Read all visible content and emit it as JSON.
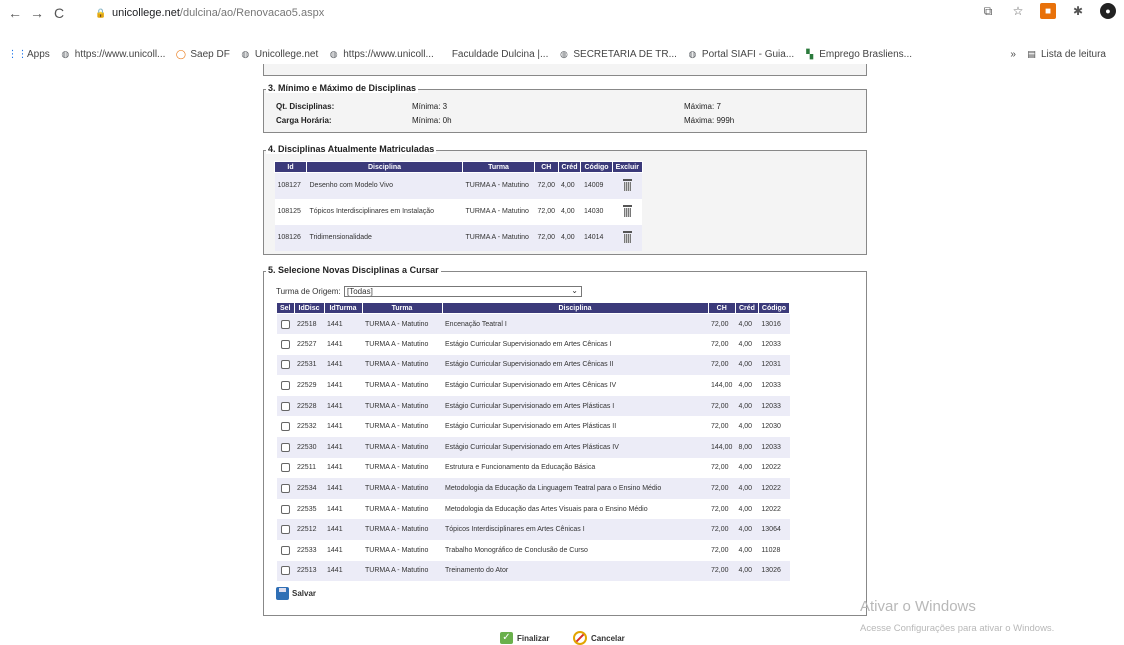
{
  "browser": {
    "url_host": "unicollege.net",
    "url_path": "/dulcina/ao/Renovacao5.aspx",
    "bookmarks": [
      {
        "label": "Apps",
        "icon": "apps-grid-icon"
      },
      {
        "label": "https://www.unicoll...",
        "icon": "globe-icon"
      },
      {
        "label": "Saep DF",
        "icon": "saep-icon"
      },
      {
        "label": "Unicollege.net",
        "icon": "globe-icon"
      },
      {
        "label": "https://www.unicoll...",
        "icon": "globe-icon"
      },
      {
        "label": "Faculdade Dulcina |...",
        "icon": "blank-icon"
      },
      {
        "label": "SECRETARIA DE TR...",
        "icon": "globe-icon"
      },
      {
        "label": "Portal SIAFI - Guia...",
        "icon": "globe-icon"
      },
      {
        "label": "Emprego Brasliens...",
        "icon": "emprego-icon"
      }
    ],
    "more_glyph": "»",
    "reading_list": "Lista de leitura"
  },
  "section3": {
    "legend": "3. Mínimo e Máximo de Disciplinas",
    "rows": [
      {
        "label": "Qt. Disciplinas:",
        "min": "Mínima: 3",
        "max": "Máxima: 7"
      },
      {
        "label": "Carga Horária:",
        "min": "Mínima: 0h",
        "max": "Máxima: 999h"
      }
    ]
  },
  "section4": {
    "legend": "4. Disciplinas Atualmente Matriculadas",
    "headers": [
      "Id",
      "Disciplina",
      "Turma",
      "CH",
      "Créd",
      "Código",
      "Excluir"
    ],
    "rows": [
      {
        "id": "108127",
        "disciplina": "Desenho com Modelo Vivo",
        "turma": "TURMA A - Matutino",
        "ch": "72,00",
        "cred": "4,00",
        "codigo": "14009"
      },
      {
        "id": "108125",
        "disciplina": "Tópicos Interdisciplinares em Instalação",
        "turma": "TURMA A - Matutino",
        "ch": "72,00",
        "cred": "4,00",
        "codigo": "14030"
      },
      {
        "id": "108126",
        "disciplina": "Tridimensionalidade",
        "turma": "TURMA A - Matutino",
        "ch": "72,00",
        "cred": "4,00",
        "codigo": "14014"
      }
    ]
  },
  "section5": {
    "legend": "5. Selecione Novas Disciplinas a Cursar",
    "origin_label": "Turma de Origem:",
    "origin_value": "[Todas]",
    "headers": [
      "Sel",
      "IdDisc",
      "IdTurma",
      "Turma",
      "Disciplina",
      "CH",
      "Créd",
      "Código"
    ],
    "rows": [
      {
        "iddisc": "22518",
        "idturma": "1441",
        "turma": "TURMA A - Matutino",
        "disciplina": "Encenação Teatral I",
        "ch": "72,00",
        "cred": "4,00",
        "codigo": "13016"
      },
      {
        "iddisc": "22527",
        "idturma": "1441",
        "turma": "TURMA A - Matutino",
        "disciplina": "Estágio Curricular Supervisionado em Artes Cênicas I",
        "ch": "72,00",
        "cred": "4,00",
        "codigo": "12033"
      },
      {
        "iddisc": "22531",
        "idturma": "1441",
        "turma": "TURMA A - Matutino",
        "disciplina": "Estágio Curricular Supervisionado em Artes Cênicas II",
        "ch": "72,00",
        "cred": "4,00",
        "codigo": "12031"
      },
      {
        "iddisc": "22529",
        "idturma": "1441",
        "turma": "TURMA A - Matutino",
        "disciplina": "Estágio Curricular Supervisionado em Artes Cênicas IV",
        "ch": "144,00",
        "cred": "4,00",
        "codigo": "12033"
      },
      {
        "iddisc": "22528",
        "idturma": "1441",
        "turma": "TURMA A - Matutino",
        "disciplina": "Estágio Curricular Supervisionado em Artes Plásticas I",
        "ch": "72,00",
        "cred": "4,00",
        "codigo": "12033"
      },
      {
        "iddisc": "22532",
        "idturma": "1441",
        "turma": "TURMA A - Matutino",
        "disciplina": "Estágio Curricular Supervisionado em Artes Plásticas II",
        "ch": "72,00",
        "cred": "4,00",
        "codigo": "12030"
      },
      {
        "iddisc": "22530",
        "idturma": "1441",
        "turma": "TURMA A - Matutino",
        "disciplina": "Estágio Curricular Supervisionado em Artes Plásticas IV",
        "ch": "144,00",
        "cred": "8,00",
        "codigo": "12033"
      },
      {
        "iddisc": "22511",
        "idturma": "1441",
        "turma": "TURMA A - Matutino",
        "disciplina": "Estrutura e Funcionamento da Educação Básica",
        "ch": "72,00",
        "cred": "4,00",
        "codigo": "12022"
      },
      {
        "iddisc": "22534",
        "idturma": "1441",
        "turma": "TURMA A - Matutino",
        "disciplina": "Metodologia da Educação da Linguagem Teatral para o Ensino Médio",
        "ch": "72,00",
        "cred": "4,00",
        "codigo": "12022"
      },
      {
        "iddisc": "22535",
        "idturma": "1441",
        "turma": "TURMA A - Matutino",
        "disciplina": "Metodologia da Educação das Artes Visuais para o Ensino Médio",
        "ch": "72,00",
        "cred": "4,00",
        "codigo": "12022"
      },
      {
        "iddisc": "22512",
        "idturma": "1441",
        "turma": "TURMA A - Matutino",
        "disciplina": "Tópicos Interdisciplinares em Artes Cênicas I",
        "ch": "72,00",
        "cred": "4,00",
        "codigo": "13064"
      },
      {
        "iddisc": "22533",
        "idturma": "1441",
        "turma": "TURMA A - Matutino",
        "disciplina": "Trabalho Monográfico de Conclusão de Curso",
        "ch": "72,00",
        "cred": "4,00",
        "codigo": "11028"
      },
      {
        "iddisc": "22513",
        "idturma": "1441",
        "turma": "TURMA A - Matutino",
        "disciplina": "Treinamento do Ator",
        "ch": "72,00",
        "cred": "4,00",
        "codigo": "13026"
      }
    ],
    "save_label": "Salvar"
  },
  "actions": {
    "finish_label": "Finalizar",
    "cancel_label": "Cancelar"
  },
  "watermark": {
    "title": "Ativar o Windows",
    "subtitle": "Acesse Configurações para ativar o Windows."
  }
}
